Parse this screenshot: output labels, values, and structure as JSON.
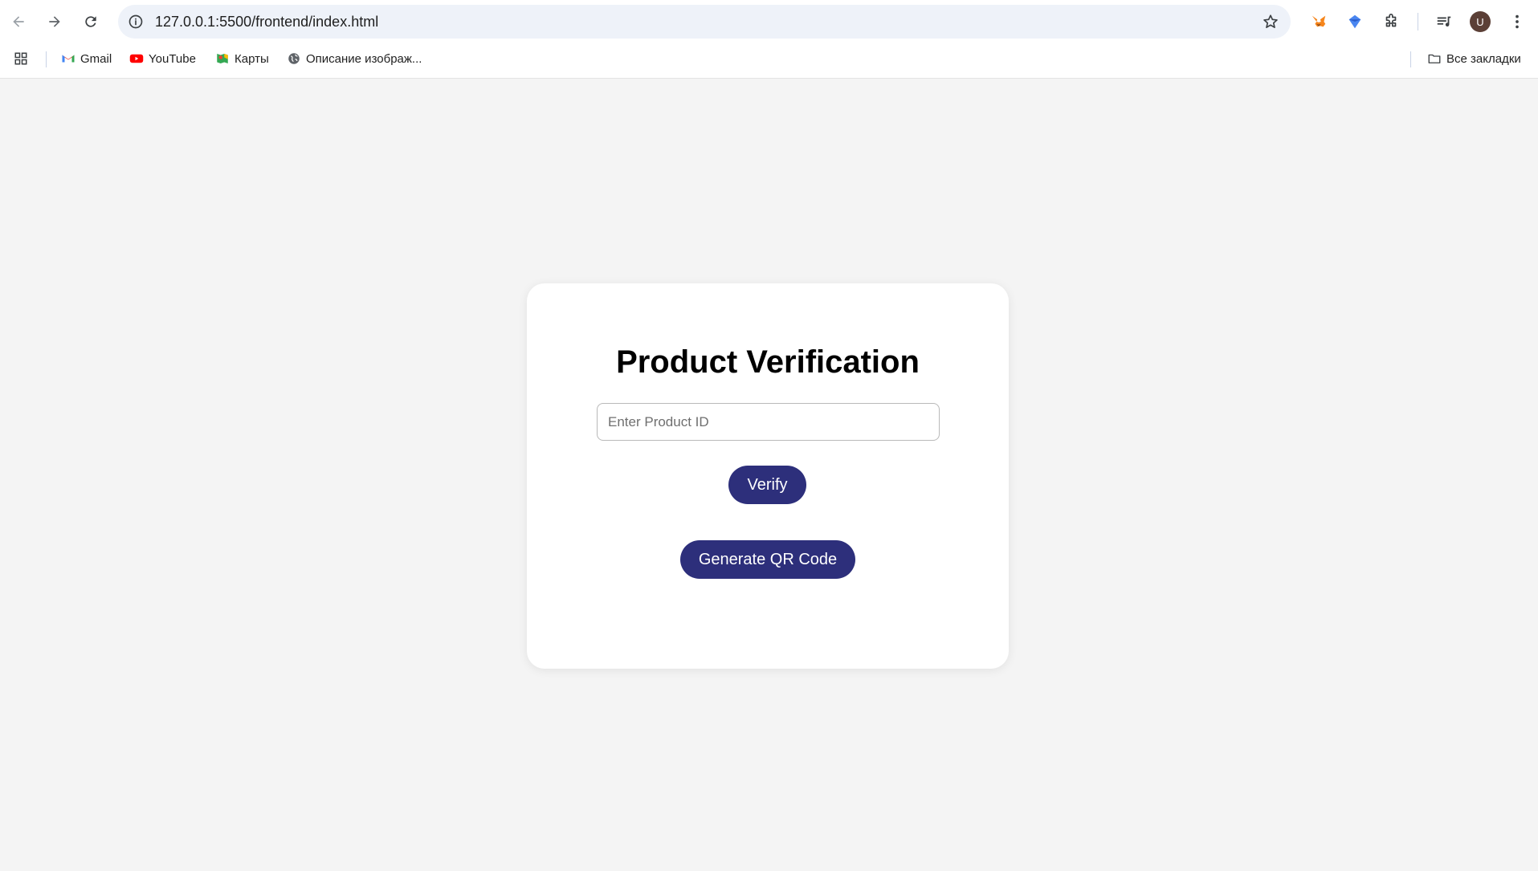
{
  "browser": {
    "url": "127.0.0.1:5500/frontend/index.html",
    "avatar_letter": "U",
    "bookmarks": [
      {
        "label": "Gmail",
        "icon": "gmail-icon"
      },
      {
        "label": "YouTube",
        "icon": "youtube-icon"
      },
      {
        "label": "Карты",
        "icon": "maps-icon"
      },
      {
        "label": "Описание изображ...",
        "icon": "globe-icon"
      }
    ],
    "all_bookmarks_label": "Все закладки"
  },
  "page": {
    "title": "Product Verification",
    "input_placeholder": "Enter Product ID",
    "input_value": "",
    "verify_label": "Verify",
    "generate_label": "Generate QR Code",
    "accent_color": "#2d2f7b",
    "background_color": "#f4f4f4"
  }
}
